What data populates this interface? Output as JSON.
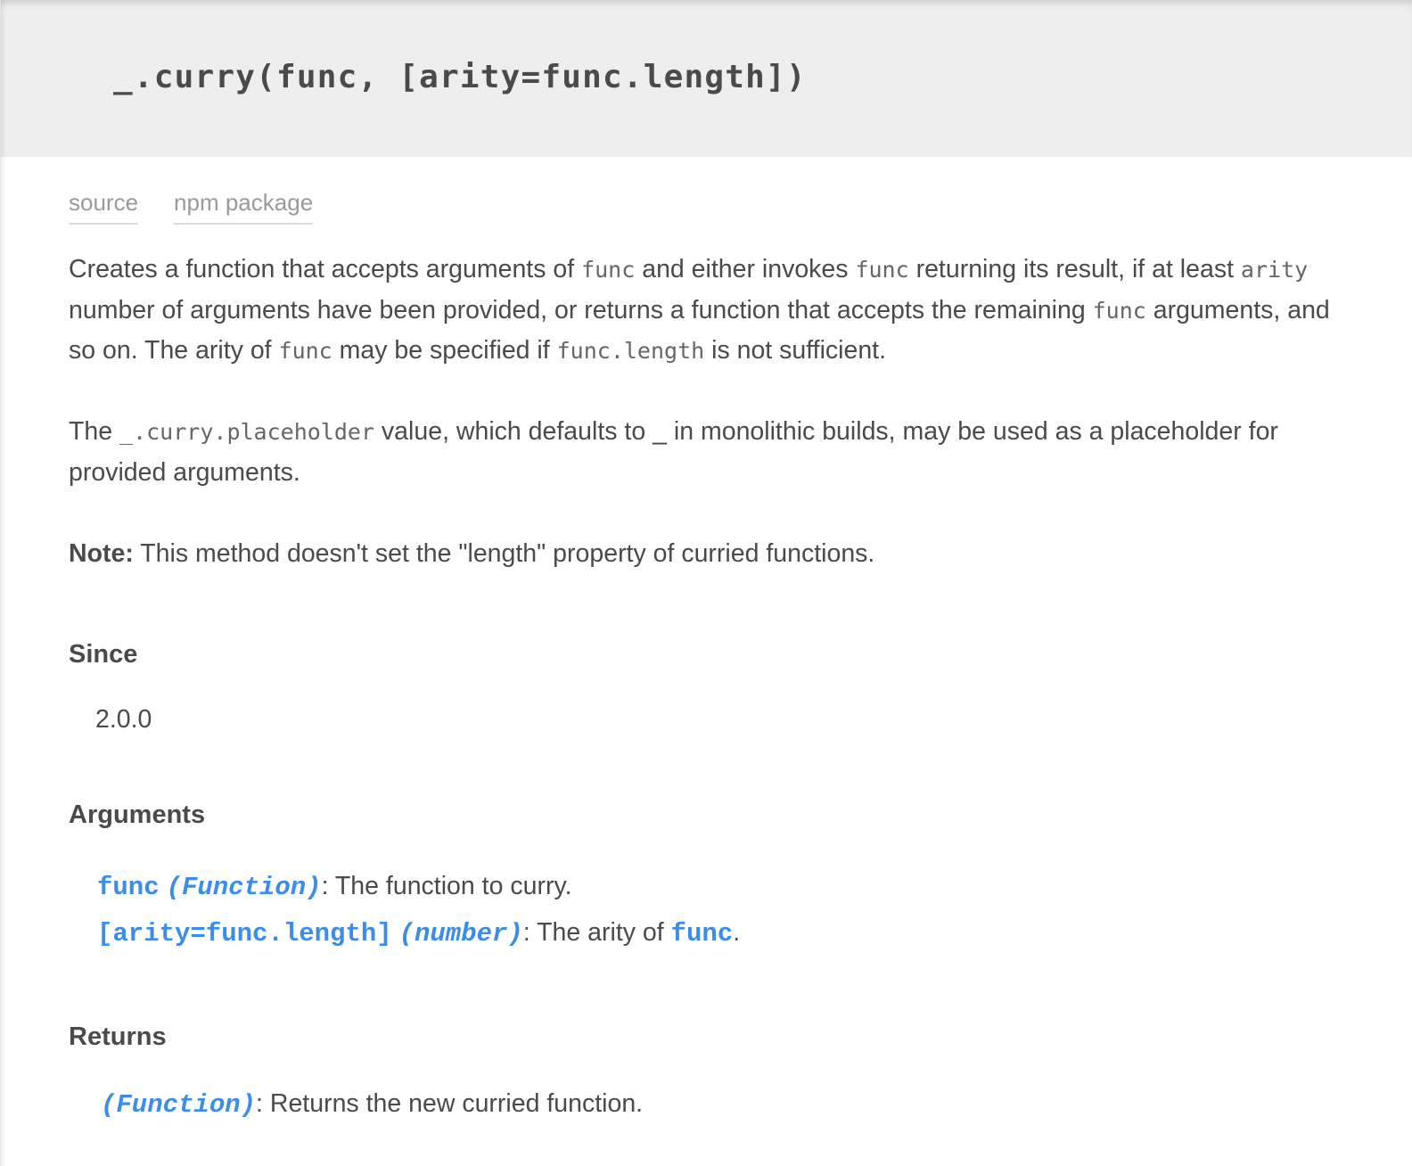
{
  "header": {
    "signature": "_.curry(func, [arity=func.length])"
  },
  "links": {
    "source": "source",
    "npm": "npm package"
  },
  "description": {
    "p1": {
      "t1": "Creates a function that accepts arguments of ",
      "c1": "func",
      "t2": " and either invokes ",
      "c2": "func",
      "t3": " returning its result, if at least ",
      "c3": "arity",
      "t4": " number of arguments have been provided, or returns a function that accepts the remaining ",
      "c4": "func",
      "t5": " arguments, and so on. The arity of ",
      "c5": "func",
      "t6": " may be specified if ",
      "c6": "func.length",
      "t7": " is not sufficient."
    },
    "p2": {
      "t1": "The ",
      "c1": "_.curry.placeholder",
      "t2": " value, which defaults to _ in monolithic builds, may be used as a placeholder for provided arguments."
    },
    "p3": {
      "label": "Note:",
      "text": " This method doesn't set the \"length\" property of curried functions."
    }
  },
  "since": {
    "heading": "Since",
    "version": "2.0.0"
  },
  "arguments": {
    "heading": "Arguments",
    "items": [
      {
        "name": "func",
        "type": "(Function)",
        "sep": ":",
        "desc": " The function to curry."
      },
      {
        "name": "[arity=func.length]",
        "type": "(number)",
        "sep": ":",
        "desc": " The arity of ",
        "ref": "func",
        "end": "."
      }
    ]
  },
  "returns": {
    "heading": "Returns",
    "type": "(Function)",
    "sep": ":",
    "desc": " Returns the new curried function."
  },
  "colors": {
    "header_bg": "#eeeeee",
    "text": "#4a4a4a",
    "link": "#9a9a9a",
    "accent_blue": "#3b8de8"
  }
}
